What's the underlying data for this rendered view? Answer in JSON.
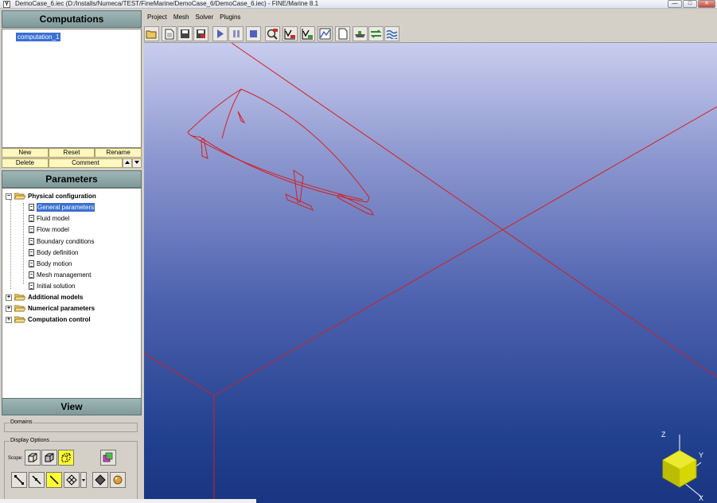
{
  "window": {
    "title": "DemoCase_6.iec (D:/Installs/Numeca/TEST/FineMarine/DemoCase_6/DemoCase_6.iec) - FINE/Marine 8.1",
    "app_icon": "Y",
    "controls": [
      "—",
      "□",
      "✕"
    ]
  },
  "computations": {
    "header": "Computations",
    "items": [
      "computation_1"
    ],
    "buttons": {
      "new": "New",
      "reset": "Reset",
      "rename": "Rename",
      "delete": "Delete",
      "comment": "Comment"
    }
  },
  "parameters": {
    "header": "Parameters",
    "tree": [
      {
        "label": "Physical configuration",
        "expanded": true,
        "children": [
          "General parameters",
          "Fluid model",
          "Flow model",
          "Boundary conditions",
          "Body definition",
          "Body motion",
          "Mesh management",
          "Initial solution"
        ]
      },
      {
        "label": "Additional models",
        "expanded": false
      },
      {
        "label": "Numerical parameters",
        "expanded": false
      },
      {
        "label": "Computation control",
        "expanded": false
      }
    ],
    "selected": "General parameters"
  },
  "view": {
    "header": "View",
    "domains_label": "Domains",
    "display_options_label": "Display Options",
    "scope_label": "Scope:"
  },
  "menu": [
    "Project",
    "Mesh",
    "Solver",
    "Plugins"
  ],
  "toolbar_icons": [
    "open-project-icon",
    "new-file-icon",
    "save-icon",
    "save-as-icon",
    "run-icon",
    "pause-icon",
    "stop-icon",
    "monitor-icon",
    "plot-residual-icon",
    "plot-quantity-icon",
    "graph-icon",
    "document-icon",
    "ship-icon",
    "transfer-icon",
    "wave-icon"
  ],
  "axes": {
    "x": "X",
    "y": "Y",
    "z": "Z"
  },
  "colors": {
    "panel_header": "#8fa8a8",
    "selection": "#3b6fd1",
    "button_yellow": "#fff7c0",
    "wireframe": "#d42020",
    "axis_cube": "#d6d600"
  }
}
